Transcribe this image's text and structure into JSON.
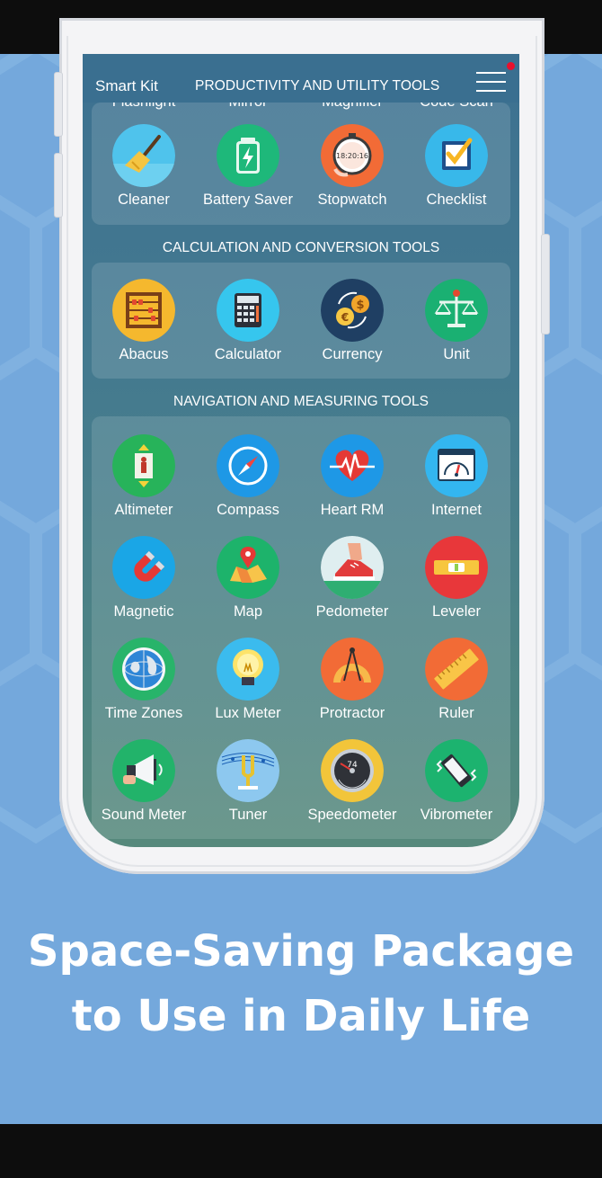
{
  "app": {
    "title": "Smart Kit",
    "menu_icon": "hamburger-menu-icon",
    "notification": "red-dot"
  },
  "sections": {
    "productivity": {
      "title": "PRODUCTIVITY AND UTILITY TOOLS",
      "partial_row": [
        "Flashlight",
        "Mirror",
        "Magnifier",
        "Code Scan"
      ],
      "items": [
        {
          "label": "Cleaner",
          "icon": "broom-icon"
        },
        {
          "label": "Battery Saver",
          "icon": "battery-icon"
        },
        {
          "label": "Stopwatch",
          "icon": "stopwatch-icon",
          "display": "18:20:16"
        },
        {
          "label": "Checklist",
          "icon": "checklist-icon"
        }
      ]
    },
    "calculation": {
      "title": "CALCULATION AND CONVERSION TOOLS",
      "items": [
        {
          "label": "Abacus",
          "icon": "abacus-icon"
        },
        {
          "label": "Calculator",
          "icon": "calculator-icon"
        },
        {
          "label": "Currency",
          "icon": "currency-exchange-icon"
        },
        {
          "label": "Unit",
          "icon": "balance-scale-icon"
        }
      ]
    },
    "navigation": {
      "title": "NAVIGATION AND MEASURING TOOLS",
      "items": [
        {
          "label": "Altimeter",
          "icon": "altimeter-icon"
        },
        {
          "label": "Compass",
          "icon": "compass-icon"
        },
        {
          "label": "Heart RM",
          "icon": "heart-rate-icon"
        },
        {
          "label": "Internet",
          "icon": "speed-gauge-browser-icon"
        },
        {
          "label": "Magnetic",
          "icon": "magnet-icon"
        },
        {
          "label": "Map",
          "icon": "map-pin-icon"
        },
        {
          "label": "Pedometer",
          "icon": "sneaker-icon"
        },
        {
          "label": "Leveler",
          "icon": "spirit-level-icon"
        },
        {
          "label": "Time Zones",
          "icon": "globe-icon"
        },
        {
          "label": "Lux Meter",
          "icon": "light-bulb-icon"
        },
        {
          "label": "Protractor",
          "icon": "protractor-icon"
        },
        {
          "label": "Ruler",
          "icon": "ruler-icon"
        },
        {
          "label": "Sound Meter",
          "icon": "megaphone-icon"
        },
        {
          "label": "Tuner",
          "icon": "tuning-fork-icon"
        },
        {
          "label": "Speedometer",
          "icon": "speedometer-icon",
          "display": "74"
        },
        {
          "label": "Vibrometer",
          "icon": "vibrating-phone-icon"
        }
      ]
    }
  },
  "tagline": {
    "line1": "Space-Saving Package",
    "line2": "to Use in Daily Life"
  },
  "colors": {
    "background": "#74a8dc",
    "appbar": "#3a6f90",
    "frame": "#f4f4f6"
  }
}
